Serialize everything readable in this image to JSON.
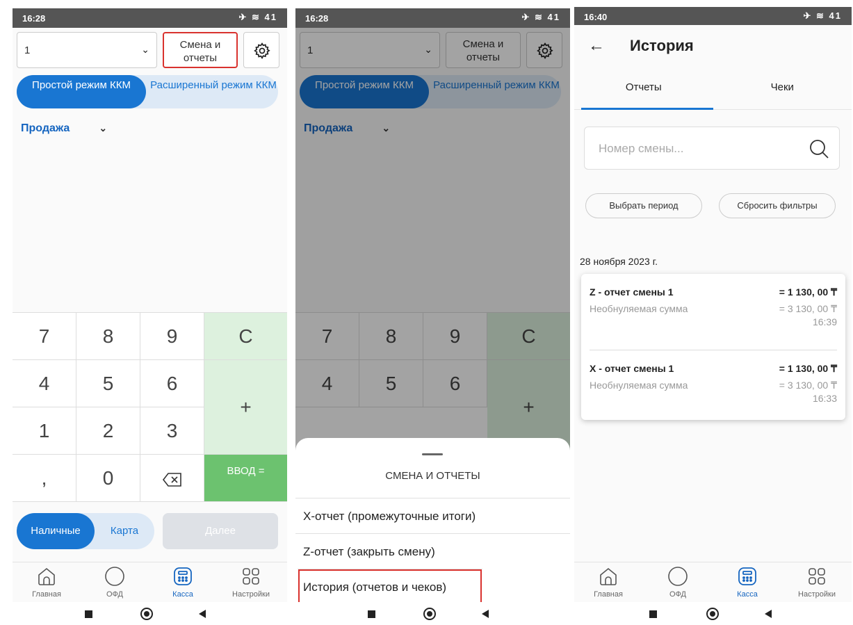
{
  "status": {
    "time1": "16:28",
    "time2": "16:28",
    "time3": "16:40",
    "icons": "✈ ≋ 41"
  },
  "kassa": {
    "register_value": "1",
    "shift_button": "Смена и отчеты",
    "mode_simple": "Простой режим ККМ",
    "mode_extended": "Расширенный режим ККМ",
    "sale_label": "Продажа",
    "keys": [
      "7",
      "8",
      "9",
      "C",
      "4",
      "5",
      "6",
      "+",
      "1",
      "2",
      "3",
      ",",
      "0",
      "ВВОД ="
    ],
    "pay_cash": "Наличные",
    "pay_card": "Карта",
    "next_button": "Далее"
  },
  "nav": {
    "home": "Главная",
    "ofd": "ОФД",
    "kassa": "Касса",
    "settings": "Настройки"
  },
  "sheet": {
    "title": "СМЕНА И ОТЧЕТЫ",
    "items": [
      "X-отчет (промежуточные итоги)",
      "Z-отчет (закрыть смену)",
      "История (отчетов и чеков)"
    ]
  },
  "history": {
    "title": "История",
    "tabs": [
      "Отчеты",
      "Чеки"
    ],
    "search_placeholder": "Номер смены...",
    "filter_period": "Выбрать период",
    "filter_reset": "Сбросить фильтры",
    "date": "28 ноября 2023 г.",
    "reports": [
      {
        "name": "Z - отчет смены 1",
        "amount": "= 1 130, 00 ₸",
        "sub": "Необнуляемая сумма",
        "subamount": "= 3 130, 00 ₸",
        "time": "16:39"
      },
      {
        "name": "X - отчет смены 1",
        "amount": "= 1 130, 00 ₸",
        "sub": "Необнуляемая сумма",
        "subamount": "= 3 130, 00 ₸",
        "time": "16:33"
      }
    ]
  },
  "colors": {
    "primary": "#1976d2",
    "highlight": "#d9322e",
    "key_green": "#ddf1de",
    "enter_green": "#6cc26f"
  }
}
